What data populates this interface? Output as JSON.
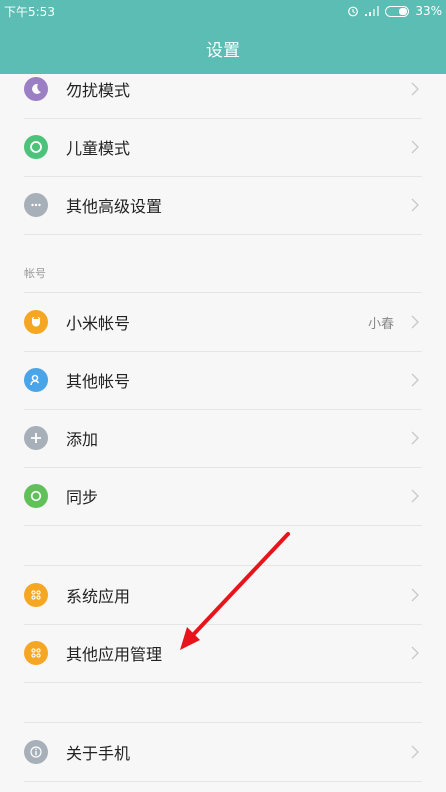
{
  "status_bar": {
    "time": "下午5:53",
    "battery": "33%"
  },
  "header": {
    "title": "设置"
  },
  "items": [
    {
      "label": "勿扰模式",
      "icon": "moon-icon",
      "color": "#9b7fc4"
    },
    {
      "label": "儿童模式",
      "icon": "child-icon",
      "color": "#4dc27a"
    },
    {
      "label": "其他高级设置",
      "icon": "more-icon",
      "color": "#a7afb8"
    },
    {
      "label": "小米帐号",
      "value": "小春",
      "icon": "mi-account-icon",
      "color": "#f5a623"
    },
    {
      "label": "其他帐号",
      "icon": "person-icon",
      "color": "#4aa5e8"
    },
    {
      "label": "添加",
      "icon": "plus-icon",
      "color": "#a7afb8"
    },
    {
      "label": "同步",
      "icon": "sync-icon",
      "color": "#62c05b"
    },
    {
      "label": "系统应用",
      "icon": "apps-icon",
      "color": "#f5a623"
    },
    {
      "label": "其他应用管理",
      "icon": "apps-icon",
      "color": "#f5a623"
    },
    {
      "label": "关于手机",
      "icon": "info-icon",
      "color": "#a7afb8"
    }
  ],
  "sections": {
    "account": "帐号"
  },
  "colors": {
    "accent": "#5cbdb4",
    "annotation_arrow": "#e8141b"
  }
}
